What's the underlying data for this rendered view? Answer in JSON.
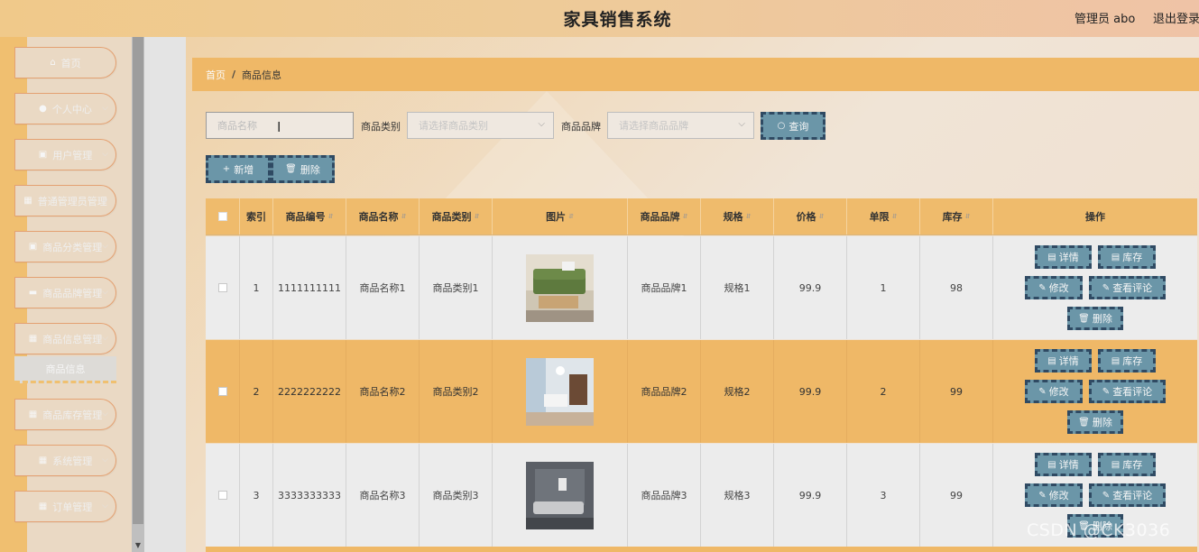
{
  "header": {
    "title": "家具销售系统",
    "admin_label": "管理员 abo",
    "logout_label": "退出登录"
  },
  "sidebar": {
    "items": [
      {
        "label": "首页",
        "icon": "home-icon",
        "glyph": "⌂",
        "has_chevron": false
      },
      {
        "label": "个人中心",
        "icon": "user-icon",
        "glyph": "●",
        "has_chevron": true
      },
      {
        "label": "用户管理",
        "icon": "clipboard-icon",
        "glyph": "▣",
        "has_chevron": true
      },
      {
        "label": "普通管理员管理",
        "icon": "grid-icon",
        "glyph": "▦",
        "has_chevron": true
      },
      {
        "label": "商品分类管理",
        "icon": "clipboard-icon",
        "glyph": "▣",
        "has_chevron": true
      },
      {
        "label": "商品品牌管理",
        "icon": "monitor-icon",
        "glyph": "▬",
        "has_chevron": true
      },
      {
        "label": "商品信息管理",
        "icon": "grid-icon",
        "glyph": "▦",
        "has_chevron": true
      },
      {
        "label": "商品库存管理",
        "icon": "grid-icon",
        "glyph": "▦",
        "has_chevron": true
      },
      {
        "label": "系统管理",
        "icon": "grid-icon",
        "glyph": "▦",
        "has_chevron": true
      },
      {
        "label": "订单管理",
        "icon": "grid-icon",
        "glyph": "▦",
        "has_chevron": true
      }
    ],
    "active_sub": "商品信息"
  },
  "breadcrumb": {
    "home": "首页",
    "separator": "/",
    "current": "商品信息"
  },
  "filters": {
    "name_placeholder": "商品名称",
    "category_label": "商品类别",
    "category_placeholder": "请选择商品类别",
    "brand_label": "商品品牌",
    "brand_placeholder": "请选择商品品牌",
    "query_label": "查询"
  },
  "actions": {
    "add_label": "新增",
    "delete_label": "删除"
  },
  "table": {
    "columns": [
      "索引",
      "商品编号",
      "商品名称",
      "商品类别",
      "图片",
      "商品品牌",
      "规格",
      "价格",
      "单限",
      "库存",
      "操作"
    ],
    "rows": [
      {
        "index": "1",
        "code": "1111111111",
        "name": "商品名称1",
        "category": "商品类别1",
        "brand": "商品品牌1",
        "spec": "规格1",
        "price": "99.9",
        "limit": "1",
        "stock": "98"
      },
      {
        "index": "2",
        "code": "2222222222",
        "name": "商品名称2",
        "category": "商品类别2",
        "brand": "商品品牌2",
        "spec": "规格2",
        "price": "99.9",
        "limit": "2",
        "stock": "99"
      },
      {
        "index": "3",
        "code": "3333333333",
        "name": "商品名称3",
        "category": "商品类别3",
        "brand": "商品品牌3",
        "spec": "规格3",
        "price": "99.9",
        "limit": "3",
        "stock": "99"
      }
    ],
    "row_actions": {
      "detail": "详情",
      "stock": "库存",
      "edit": "修改",
      "reviews": "查看评论",
      "delete": "删除"
    }
  },
  "watermark": "CSDN @CK3036"
}
